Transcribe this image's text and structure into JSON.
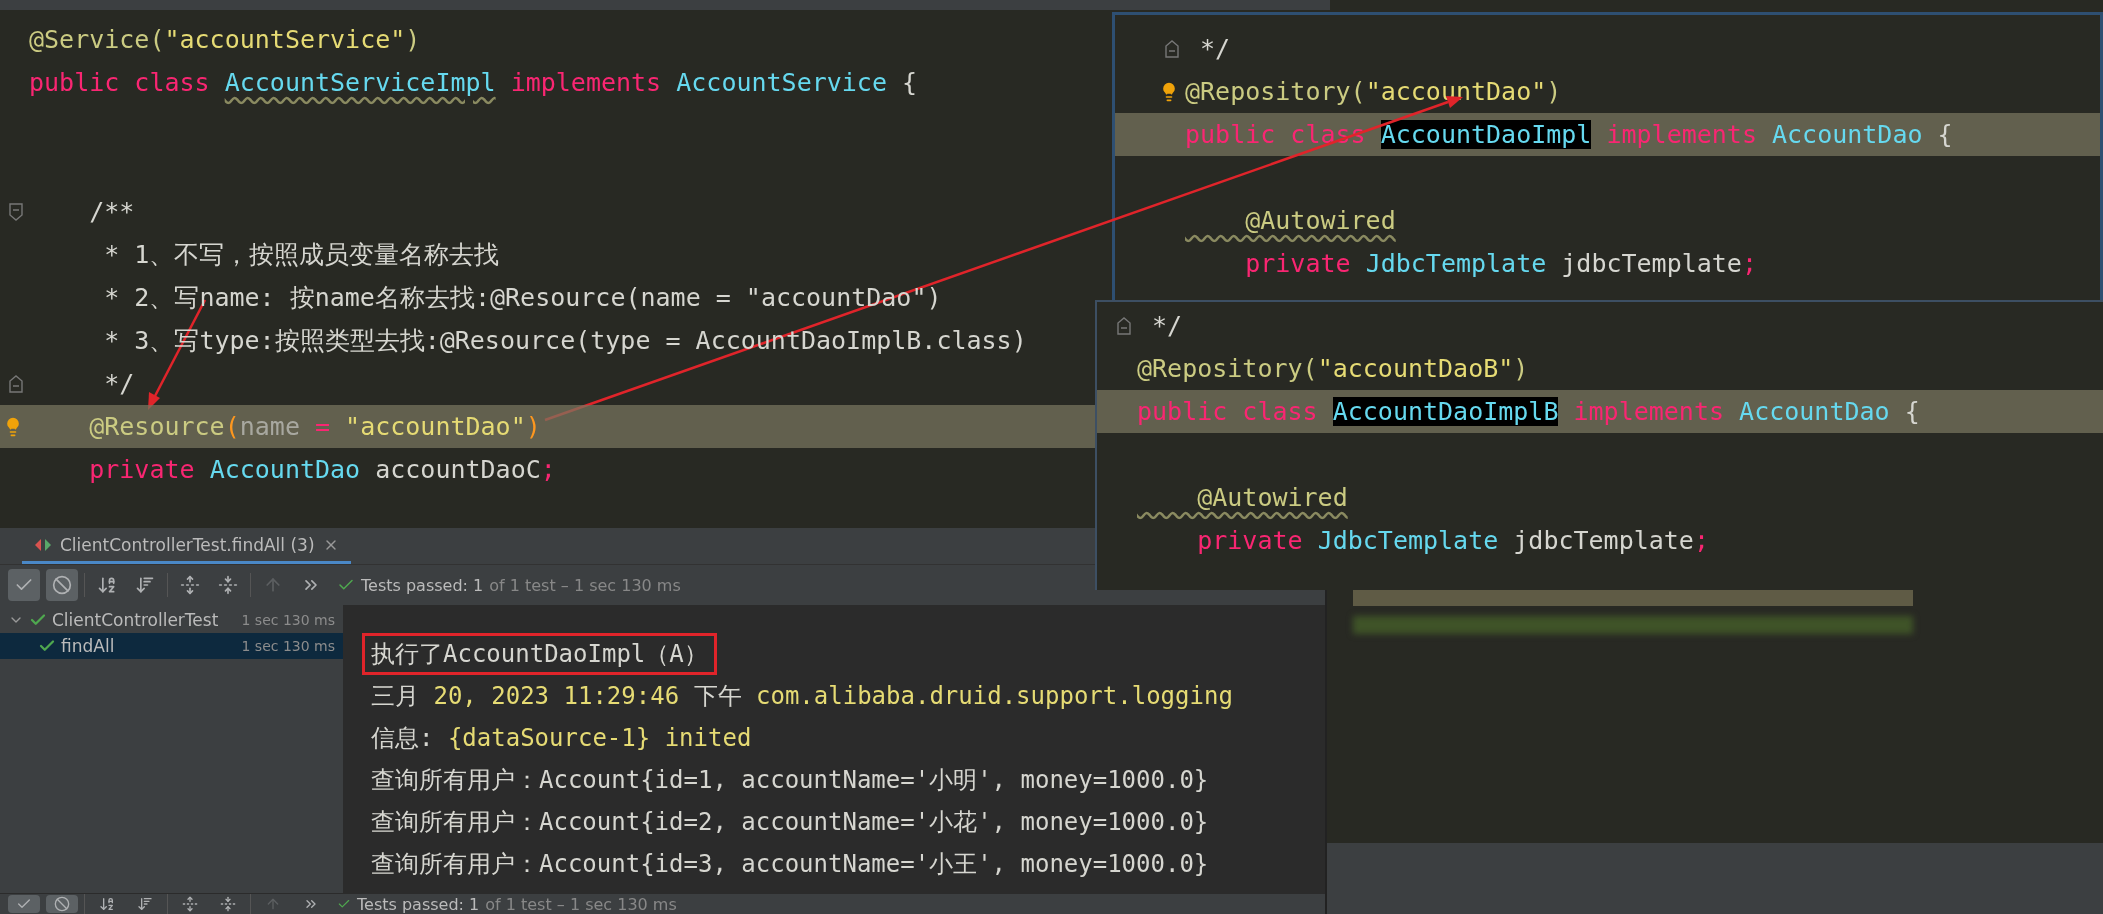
{
  "main_editor": {
    "lines": [
      {
        "highlighted": false,
        "tokens": [
          {
            "text": "@Service(",
            "kind": "annotation"
          },
          {
            "text": "\"accountService\"",
            "kind": "string"
          },
          {
            "text": ")",
            "kind": "annotation"
          }
        ]
      },
      {
        "highlighted": false,
        "tokens": [
          {
            "text": "public class ",
            "kind": "keyword"
          },
          {
            "text": "AccountServiceImpl",
            "kind": "type-wavy"
          },
          {
            "text": " implements ",
            "kind": "keyword"
          },
          {
            "text": "AccountService",
            "kind": "type"
          },
          {
            "text": " {",
            "kind": "plain"
          }
        ]
      },
      {
        "highlighted": false
      },
      {
        "highlighted": false
      },
      {
        "highlighted": false,
        "gutter": {
          "kind": "fold-start"
        },
        "tokens": [
          {
            "text": "    /**",
            "kind": "plain"
          }
        ]
      },
      {
        "highlighted": false,
        "tokens": [
          {
            "text": "     * 1、不写，按照成员变量名称去找",
            "kind": "plain"
          }
        ]
      },
      {
        "highlighted": false,
        "tokens": [
          {
            "text": "     * 2、写name: 按name名称去找:@Resource(name = \"accountDao\")",
            "kind": "plain"
          }
        ]
      },
      {
        "highlighted": false,
        "tokens": [
          {
            "text": "     * 3、写type:按照类型去找:@Resource(type = AccountDaoImplB.class)",
            "kind": "plain"
          }
        ]
      },
      {
        "highlighted": false,
        "gutter": {
          "kind": "fold-end"
        },
        "tokens": [
          {
            "text": "     */",
            "kind": "plain"
          }
        ]
      },
      {
        "highlighted": true,
        "gutter": {
          "kind": "bulb"
        },
        "tokens": [
          {
            "text": "    @Resource",
            "kind": "annotation"
          },
          {
            "text": "(",
            "kind": "bracket"
          },
          {
            "text": "name",
            "kind": "param"
          },
          {
            "text": " = ",
            "kind": "keyword"
          },
          {
            "text": "\"accountDao\"",
            "kind": "string"
          },
          {
            "text": ")",
            "kind": "bracket"
          }
        ]
      },
      {
        "highlighted": false,
        "tokens": [
          {
            "text": "    private ",
            "kind": "keyword"
          },
          {
            "text": "AccountDao",
            "kind": "type"
          },
          {
            "text": " accountDaoC",
            "kind": "plain"
          },
          {
            "text": ";",
            "kind": "keyword"
          }
        ]
      }
    ]
  },
  "panel_a": {
    "lines": [
      {
        "highlighted": false,
        "gutter": {
          "kind": "fold-end"
        },
        "tokens": [
          {
            "text": " */",
            "kind": "plain"
          }
        ]
      },
      {
        "highlighted": false,
        "gutter": {
          "kind": "bulb"
        },
        "tokens": [
          {
            "text": "@Repository(",
            "kind": "annotation"
          },
          {
            "text": "\"accountDao\"",
            "kind": "string"
          },
          {
            "text": ")",
            "kind": "annotation"
          }
        ]
      },
      {
        "highlighted": true,
        "tokens": [
          {
            "text": "public class ",
            "kind": "keyword"
          },
          {
            "text": "AccountDaoImpl",
            "kind": "type-selected"
          },
          {
            "text": " implements ",
            "kind": "keyword"
          },
          {
            "text": "AccountDao",
            "kind": "type"
          },
          {
            "text": " {",
            "kind": "plain"
          }
        ]
      },
      {
        "highlighted": false
      },
      {
        "highlighted": false,
        "tokens": [
          {
            "text": "    @Autowired",
            "kind": "annotation-wavy"
          }
        ]
      },
      {
        "highlighted": false,
        "tokens": [
          {
            "text": "    private ",
            "kind": "keyword"
          },
          {
            "text": "JdbcTemplate",
            "kind": "type"
          },
          {
            "text": " jdbcTemplate",
            "kind": "plain"
          },
          {
            "text": ";",
            "kind": "keyword"
          }
        ]
      }
    ]
  },
  "panel_b": {
    "lines": [
      {
        "highlighted": false,
        "gutter": {
          "kind": "fold-end"
        },
        "tokens": [
          {
            "text": " */",
            "kind": "plain"
          }
        ]
      },
      {
        "highlighted": false,
        "tokens": [
          {
            "text": "@Repository(",
            "kind": "annotation"
          },
          {
            "text": "\"accountDaoB\"",
            "kind": "string"
          },
          {
            "text": ")",
            "kind": "annotation"
          }
        ]
      },
      {
        "highlighted": true,
        "tokens": [
          {
            "text": "public class ",
            "kind": "keyword"
          },
          {
            "text": "AccountDaoImplB",
            "kind": "type-selected"
          },
          {
            "text": " implements ",
            "kind": "keyword"
          },
          {
            "text": "AccountDao",
            "kind": "type"
          },
          {
            "text": " {",
            "kind": "plain"
          }
        ]
      },
      {
        "highlighted": false
      },
      {
        "highlighted": false,
        "tokens": [
          {
            "text": "    @Autowired",
            "kind": "annotation-wavy"
          }
        ]
      },
      {
        "highlighted": false,
        "tokens": [
          {
            "text": "    private ",
            "kind": "keyword"
          },
          {
            "text": "JdbcTemplate",
            "kind": "type"
          },
          {
            "text": " jdbcTemplate",
            "kind": "plain"
          },
          {
            "text": ";",
            "kind": "keyword"
          }
        ]
      }
    ]
  },
  "run_panel": {
    "tab": {
      "label": "ClientControllerTest.findAll (3)"
    },
    "toolbar": {
      "buttons": [
        {
          "kind": "passed",
          "selected": true,
          "disabled": false
        },
        {
          "kind": "ignored",
          "selected": true,
          "disabled": false
        },
        {
          "kind": "sort-alpha",
          "selected": false,
          "disabled": false
        },
        {
          "kind": "sort-duration",
          "selected": false,
          "disabled": false
        },
        {
          "kind": "expand",
          "selected": false,
          "disabled": false
        },
        {
          "kind": "collapse",
          "selected": false,
          "disabled": false
        },
        {
          "kind": "previous",
          "selected": false,
          "disabled": true
        },
        {
          "kind": "more",
          "selected": false,
          "disabled": false
        }
      ],
      "status": {
        "main": "Tests passed: 1",
        "detail": "of 1 test – 1 sec 130 ms"
      }
    },
    "tree": [
      {
        "label": "ClientControllerTest",
        "time": "1 sec 130 ms",
        "passed": true,
        "selected": false,
        "expanded": true,
        "children": [
          {
            "label": "findAll",
            "time": "1 sec 130 ms",
            "passed": true,
            "selected": true
          }
        ]
      }
    ],
    "console": [
      {
        "boxed": true,
        "tokens": [
          {
            "text": "执行了AccountDaoImpl（A）",
            "kind": "plain"
          }
        ]
      },
      {
        "boxed": false,
        "tokens": [
          {
            "text": "三月 ",
            "kind": "plain"
          },
          {
            "text": "20, 2023 11:29:46 ",
            "kind": "log"
          },
          {
            "text": "下午 ",
            "kind": "plain"
          },
          {
            "text": "com.alibaba.druid.support.logging",
            "kind": "log"
          }
        ]
      },
      {
        "boxed": false,
        "tokens": [
          {
            "text": "信息: ",
            "kind": "plain"
          },
          {
            "text": "{dataSource-1} inited",
            "kind": "log"
          }
        ]
      },
      {
        "boxed": false,
        "tokens": [
          {
            "text": "查询所有用户：Account{id=1, accountName='小明', money=1000.0}",
            "kind": "plain"
          }
        ]
      },
      {
        "boxed": false,
        "tokens": [
          {
            "text": "查询所有用户：Account{id=2, accountName='小花', money=1000.0}",
            "kind": "plain"
          }
        ]
      },
      {
        "boxed": false,
        "tokens": [
          {
            "text": "查询所有用户：Account{id=3, accountName='小王', money=1000.0}",
            "kind": "plain"
          }
        ]
      }
    ],
    "bottom_toolbar": {
      "buttons": [
        {
          "kind": "passed",
          "selected": true,
          "disabled": false
        },
        {
          "kind": "ignored",
          "selected": true,
          "disabled": false
        },
        {
          "kind": "sort-alpha",
          "selected": false,
          "disabled": false
        },
        {
          "kind": "sort-duration",
          "selected": false,
          "disabled": false
        },
        {
          "kind": "expand",
          "selected": false,
          "disabled": false
        },
        {
          "kind": "collapse",
          "selected": false,
          "disabled": false
        },
        {
          "kind": "previous",
          "selected": false,
          "disabled": true
        },
        {
          "kind": "more",
          "selected": false,
          "disabled": false
        }
      ],
      "status": {
        "main": "Tests passed: 1",
        "detail": "of 1 test – 1 sec 130 ms"
      }
    }
  }
}
